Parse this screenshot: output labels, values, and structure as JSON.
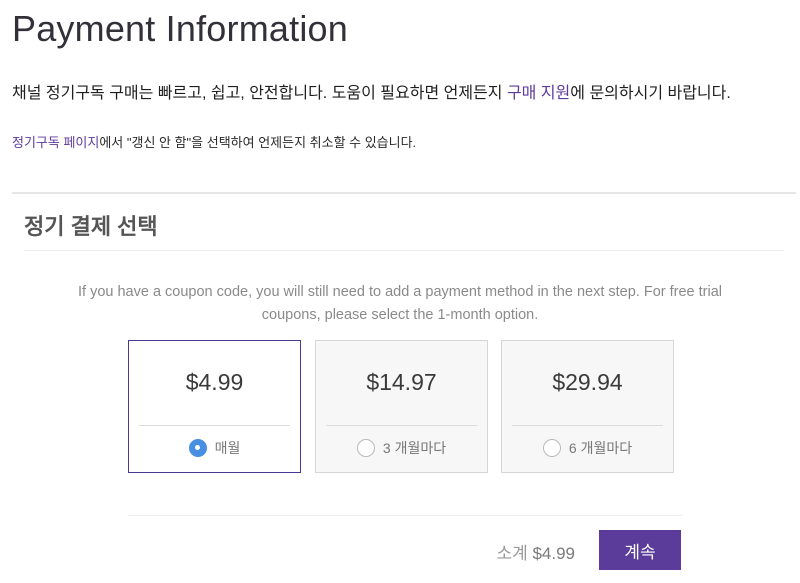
{
  "header": {
    "title": "Payment Information"
  },
  "intro": {
    "text_before": "채널 정기구독 구매는 빠르고, 쉽고, 안전합니다. 도움이 필요하면 언제든지 ",
    "link": "구매 지원",
    "text_after": "에 문의하시기 바랍니다."
  },
  "cancel_note": {
    "link": "정기구독 페이지",
    "text": "에서 \"갱신 안 함\"을 선택하여 언제든지 취소할 수 있습니다."
  },
  "section": {
    "title": "정기 결제 선택"
  },
  "coupon_note": {
    "line1": "If you have a coupon code, you will still need to add a payment method in the next step. For free trial",
    "line2": "coupons, please select the 1-month option."
  },
  "plans": [
    {
      "price": "$4.99",
      "label": "매월",
      "selected": true
    },
    {
      "price": "$14.97",
      "label": "3 개월마다",
      "selected": false
    },
    {
      "price": "$29.94",
      "label": "6 개월마다",
      "selected": false
    }
  ],
  "summary": {
    "subtotal_label": "소계",
    "subtotal_value": "$4.99"
  },
  "actions": {
    "continue_label": "계속"
  },
  "colors": {
    "accent": "#5b3c9b",
    "link": "#5c3a9e",
    "radio_selected": "#4a90e2"
  }
}
